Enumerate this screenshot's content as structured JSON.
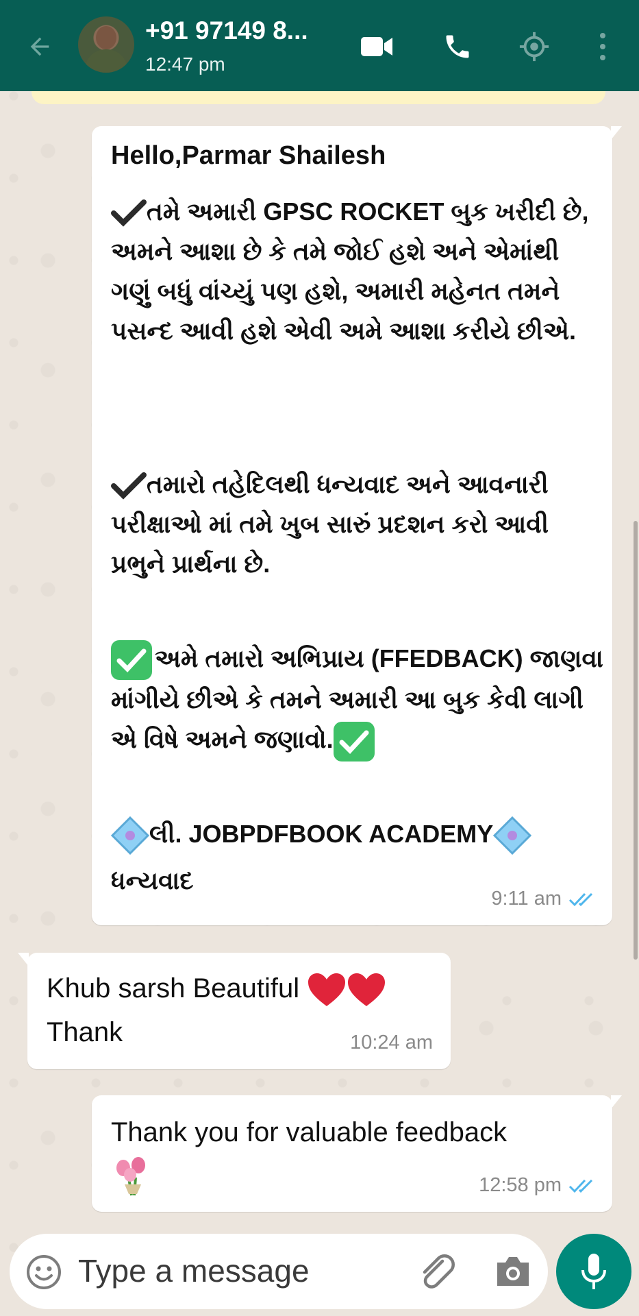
{
  "header": {
    "contact_name": "+91 97149 8...",
    "status": "12:47 pm",
    "back_icon": "arrow-back-icon",
    "video_icon": "video-call-icon",
    "call_icon": "phone-icon",
    "location_icon": "live-location-icon",
    "menu_icon": "more-vertical-icon",
    "bg_color": "#075e54"
  },
  "messages": [
    {
      "direction": "outgoing",
      "greeting": "Hello,Parmar Shailesh",
      "paragraph_1": "તમે અમારી GPSC ROCKET બુક ખરીદી છે, અમને આશા છે કે તમે જોઈ હશે અને એમાંથી ગણું બધું વાંચ્યું પણ હશે, અમારી મહેનત તમને પસન્દ આવી હશે એવી અમે આશા કરીયે છીએ.",
      "paragraph_2": "તમારો તહેદિલથી ધન્યવાદ અને આવનારી પરીક્ષાઓ માં તમે ખુબ સારું પ્રદશન કરો આવી પ્રભુને પ્રાર્થના છે.",
      "paragraph_3": "અમે તમારો અભિપ્રાય (FFEDBACK) જાણવા માંગીયે છીએ કે તમને અમારી આ બુક કેવી લાગી એ વિષે અમને જણાવો.",
      "paragraph_4": "લી. JOBPDFBOOK ACADEMY",
      "paragraph_5": "ધન્યવાદ",
      "time": "9:11 am",
      "status": "read"
    },
    {
      "direction": "incoming",
      "text_line_1": "Khub sarsh Beautiful",
      "text_line_2": "Thank",
      "time": "10:24 am"
    },
    {
      "direction": "outgoing",
      "text": "Thank you for valuable feedback",
      "time": "12:58 pm",
      "status": "read"
    }
  ],
  "input": {
    "placeholder": "Type a message",
    "emoji_icon": "emoji-icon",
    "attach_icon": "paperclip-icon",
    "camera_icon": "camera-icon",
    "mic_icon": "mic-icon",
    "accent": "#00897b"
  },
  "colors": {
    "read_tick": "#4fb6ec",
    "wallpaper": "#ece5dd"
  }
}
